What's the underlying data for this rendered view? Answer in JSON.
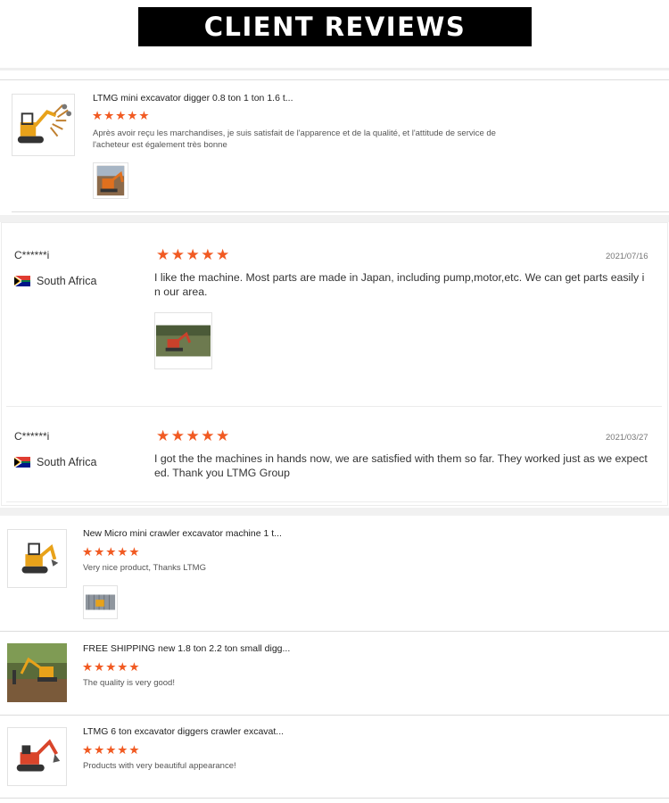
{
  "header": {
    "title": "CLIENT REVIEWS"
  },
  "product_reviews_top": [
    {
      "title": "LTMG mini excavator digger 0.8 ton 1 ton 1.6 t...",
      "stars": "★★★★★",
      "text": "Après avoir reçu les marchandises, je suis satisfait de l'apparence et de la qualité, et l'attitude de service de l'acheteur est également très bonne",
      "thumb_icon": "mini-excavator-with-attachments-image",
      "photo_icon": "excavator-photo"
    }
  ],
  "customer_reviews": [
    {
      "user": "C******i",
      "country": "South Africa",
      "flag_icon": "south-africa-flag-icon",
      "stars": "★★★★★",
      "date": "2021/07/16",
      "text": "I like the machine. Most parts are made in Japan, including pump,motor,etc. We can get parts easily i n our area.",
      "photo_icon": "excavator-in-field-photo"
    },
    {
      "user": "C******i",
      "country": "South Africa",
      "flag_icon": "south-africa-flag-icon",
      "stars": "★★★★★",
      "date": "2021/03/27",
      "text": "I got the the machines in hands now, we are satisfied with them so far. They worked just as we expect ed. Thank you LTMG Group"
    }
  ],
  "product_reviews_bottom": [
    {
      "title": "New Micro mini crawler excavator machine 1 t...",
      "stars": "★★★★★",
      "text": "Very nice product, Thanks LTMG",
      "thumb_icon": "micro-excavator-image",
      "photo_icon": "container-photo"
    },
    {
      "title": "FREE SHIPPING new 1.8 ton 2.2 ton small digg...",
      "stars": "★★★★★",
      "text": "The quality is very good!",
      "thumb_icon": "small-digger-working-image"
    },
    {
      "title": "LTMG 6 ton excavator diggers crawler excavat...",
      "stars": "★★★★★",
      "text": "Products with very beautiful appearance!",
      "thumb_icon": "red-excavator-image"
    }
  ],
  "colors": {
    "star": "#f15a22",
    "banner_bg": "#000000",
    "excavator_yellow": "#e8a21a",
    "excavator_red": "#d9452b"
  }
}
